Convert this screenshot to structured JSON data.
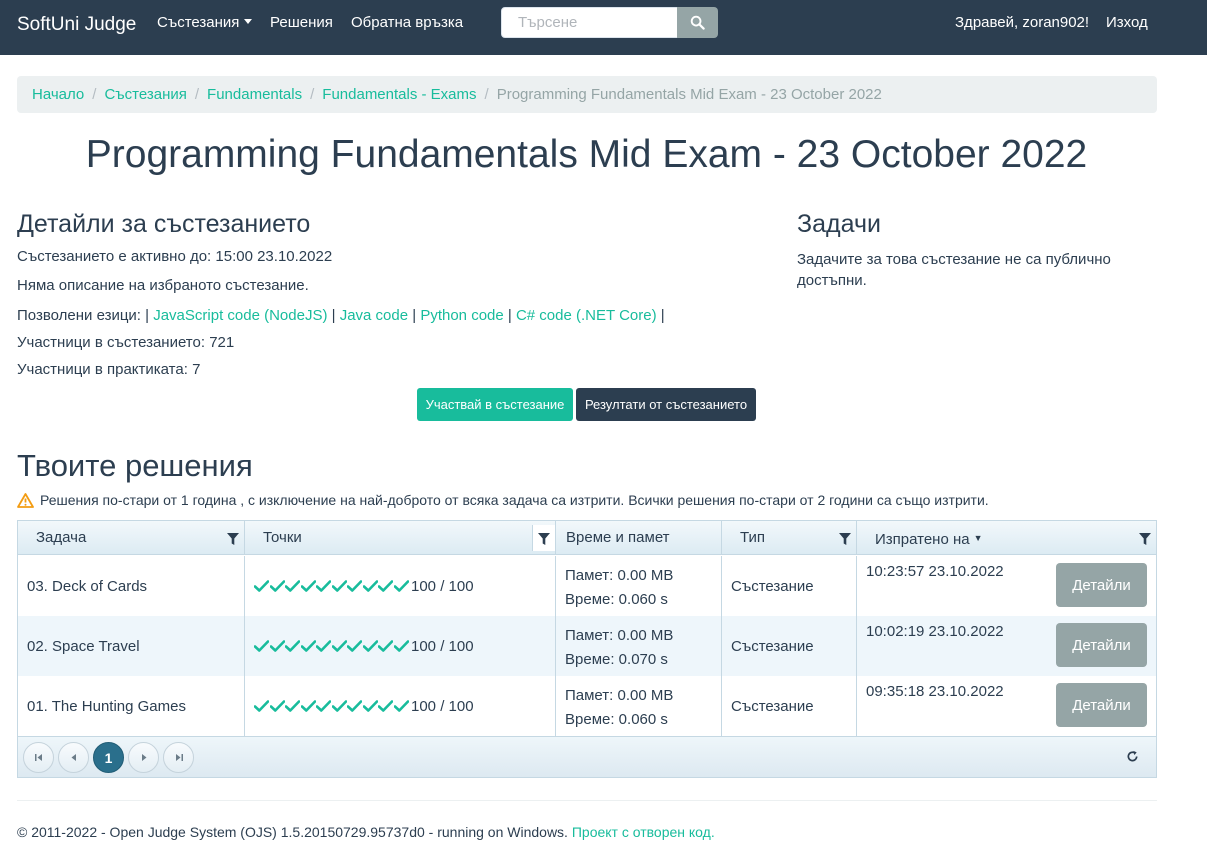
{
  "navbar": {
    "brand": "SoftUni Judge",
    "contests": "Състезания",
    "submissions": "Решения",
    "feedback": "Обратна връзка",
    "search_placeholder": "Търсене",
    "greeting": "Здравей, zoran902!",
    "logout": "Изход",
    "color": "#2c3e50"
  },
  "breadcrumb": {
    "items": [
      "Начало",
      "Състезания",
      "Fundamentals",
      "Fundamentals - Exams"
    ],
    "active": "Programming Fundamentals Mid Exam - 23 October 2022"
  },
  "page_title": "Programming Fundamentals Mid Exam - 23 October 2022",
  "details": {
    "heading": "Детайли за състезанието",
    "active_until": "Състезанието е активно до: 15:00 23.10.2022",
    "no_description": "Няма описание на избраното състезание.",
    "languages_label": "Позволени езици:",
    "languages": [
      "JavaScript code (NodeJS)",
      "Java code",
      "Python code",
      "C# code (.NET Core)"
    ],
    "participants": "Участници в състезанието: 721",
    "practice_participants": "Участници в практиката: 7",
    "participate_button": "Участвай в състезание",
    "results_button": "Резултати от състезанието"
  },
  "tasks": {
    "heading": "Задачи",
    "note": "Задачите за това състезание не са публично достъпни."
  },
  "submissions": {
    "heading": "Твоите решения",
    "warning": "Решения по-стари от 1 година , с изключение на най-доброто от всяка задача са изтрити. Всички решения по-стари от 2 години са също изтрити.",
    "columns": {
      "task": "Задача",
      "points": "Точки",
      "time_memory": "Време и памет",
      "type": "Тип",
      "sent_on": "Изпратено на"
    },
    "rows": [
      {
        "task": "03. Deck of Cards",
        "checks": 10,
        "score": "100 / 100",
        "memory": "Памет: 0.00 MB",
        "time": "Време: 0.060 s",
        "type": "Състезание",
        "sent": "10:23:57 23.10.2022",
        "button": "Детайли"
      },
      {
        "task": "02. Space Travel",
        "checks": 10,
        "score": "100 / 100",
        "memory": "Памет: 0.00 MB",
        "time": "Време: 0.070 s",
        "type": "Състезание",
        "sent": "10:02:19 23.10.2022",
        "button": "Детайли"
      },
      {
        "task": "01. The Hunting Games",
        "checks": 10,
        "score": "100 / 100",
        "memory": "Памет: 0.00 MB",
        "time": "Време: 0.060 s",
        "type": "Състезание",
        "sent": "09:35:18 23.10.2022",
        "button": "Детайли"
      }
    ],
    "current_page": "1"
  },
  "footer": {
    "text": "© 2011-2022 - Open Judge System (OJS) 1.5.20150729.95737d0 - running on Windows. ",
    "link": "Проект с отворен код."
  },
  "colors": {
    "accent": "#18bc9c",
    "dark": "#2c3e50",
    "muted": "#95a5a6",
    "warning": "#f39c12"
  }
}
